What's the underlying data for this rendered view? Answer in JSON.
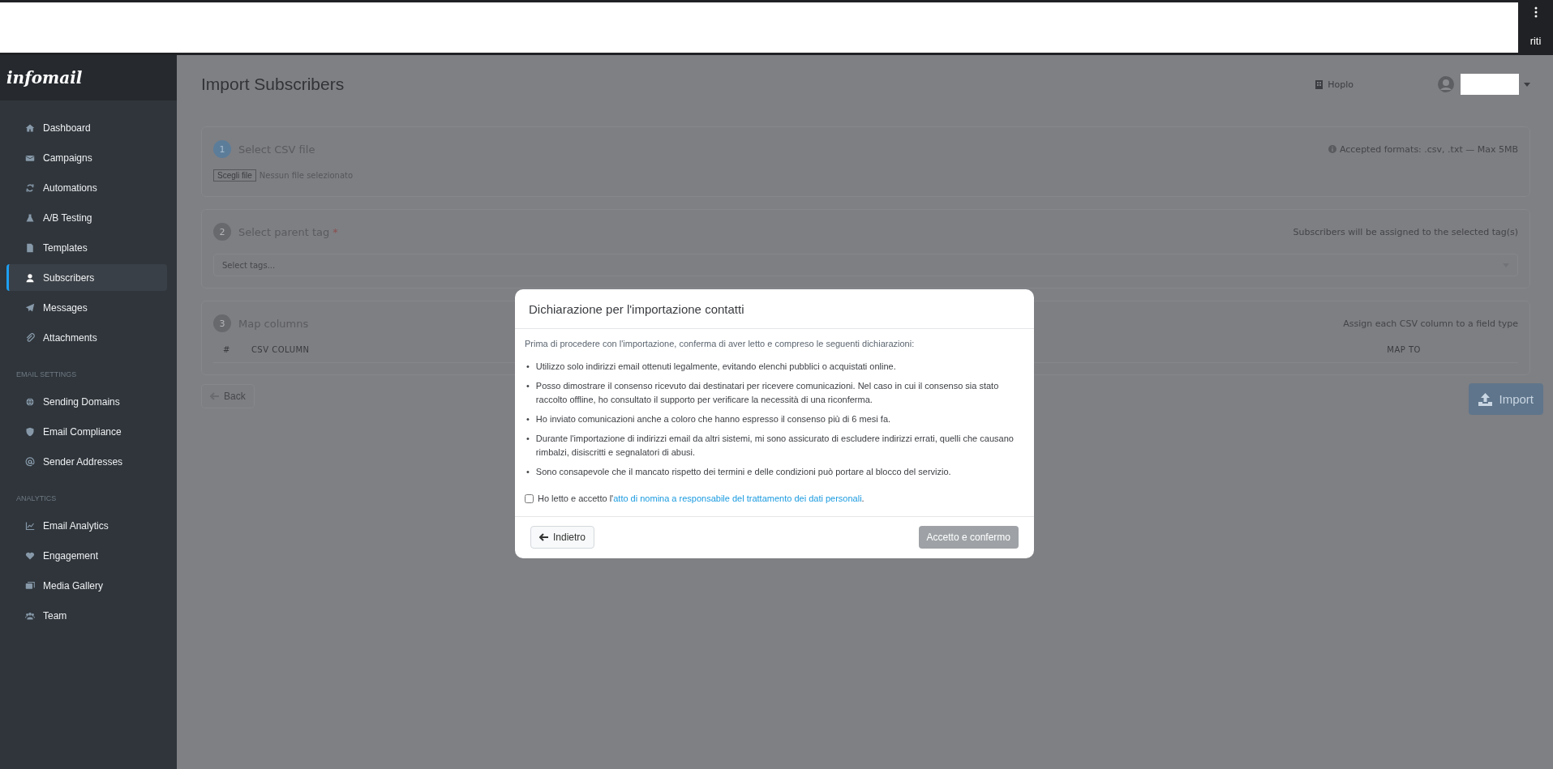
{
  "browser_bar": {
    "menu_text": "riti"
  },
  "sidebar": {
    "logo": "infomail",
    "sections": [
      {
        "items": [
          {
            "label": "Dashboard",
            "selected": false
          },
          {
            "label": "Campaigns",
            "selected": false
          },
          {
            "label": "Automations",
            "selected": false
          },
          {
            "label": "A/B Testing",
            "selected": false
          },
          {
            "label": "Templates",
            "selected": false
          },
          {
            "label": "Subscribers",
            "selected": true
          },
          {
            "label": "Messages",
            "selected": false
          },
          {
            "label": "Attachments",
            "selected": false
          }
        ]
      },
      {
        "heading": "EMAIL SETTINGS",
        "items": [
          {
            "label": "Sending Domains",
            "selected": false
          },
          {
            "label": "Email Compliance",
            "selected": false
          },
          {
            "label": "Sender Addresses",
            "selected": false
          }
        ]
      },
      {
        "heading": "ANALYTICS",
        "items": [
          {
            "label": "Email Analytics",
            "selected": false
          },
          {
            "label": "Engagement",
            "selected": false
          },
          {
            "label": "Media Gallery",
            "selected": false
          },
          {
            "label": "Team",
            "selected": false
          }
        ]
      }
    ]
  },
  "header": {
    "title": "Import Subscribers",
    "workspace": "Hoplo"
  },
  "steps": [
    {
      "kind": "file",
      "number": "1",
      "title": "Select CSV file",
      "active": true,
      "hint": "Accepted formats: .csv, .txt — Max 5MB",
      "file_button": "Scegli file",
      "file_status": "Nessun file selezionato"
    },
    {
      "kind": "tags",
      "number": "2",
      "title": "Select parent tag",
      "active": false,
      "required_mark": "*",
      "hint": "Subscribers will be assigned to the selected tag(s)",
      "placeholder": "Select tags..."
    },
    {
      "kind": "mapping",
      "number": "3",
      "title": "Map columns",
      "active": false,
      "hint": "Assign each CSV column to a field type",
      "columns": [
        "#",
        "CSV COLUMN",
        "MAP TO"
      ]
    }
  ],
  "back_button": "Back",
  "import_button": {
    "label": "Import",
    "disabled": true
  },
  "modal": {
    "title": "Dichiarazione per l'importazione contatti",
    "intro": "Prima di procedere con l'importazione, conferma di aver letto e compreso le seguenti dichiarazioni:",
    "statements": [
      {
        "bullet": "•",
        "text": "Utilizzo solo indirizzi email ottenuti legalmente, evitando elenchi pubblici o acquistati online."
      },
      {
        "bullet": "•",
        "text": "Posso dimostrare il consenso ricevuto dai destinatari per ricevere comunicazioni. Nel caso in cui il consenso sia stato raccolto offline, ho consultato il supporto per verificare la necessità di una riconferma."
      },
      {
        "bullet": "•",
        "text": "Ho inviato comunicazioni anche a coloro che hanno espresso il consenso più di 6 mesi fa."
      },
      {
        "bullet": "•",
        "text": "Durante l'importazione di indirizzi email da altri sistemi, mi sono assicurato di escludere indirizzi errati, quelli che causano rimbalzi, disiscritti e segnalatori di abusi."
      },
      {
        "bullet": "•",
        "text": "Sono consapevole che il mancato rispetto dei termini e delle condizioni può portare al blocco del servizio."
      }
    ],
    "consent": {
      "checked": false,
      "text_before": "Ho letto e accetto l'",
      "link": "atto di nomina a responsabile del trattamento dei dati personali",
      "text_after": "."
    },
    "back_button": "Indietro",
    "confirm_button": {
      "label": "Accetto e confermo",
      "disabled": true
    }
  }
}
